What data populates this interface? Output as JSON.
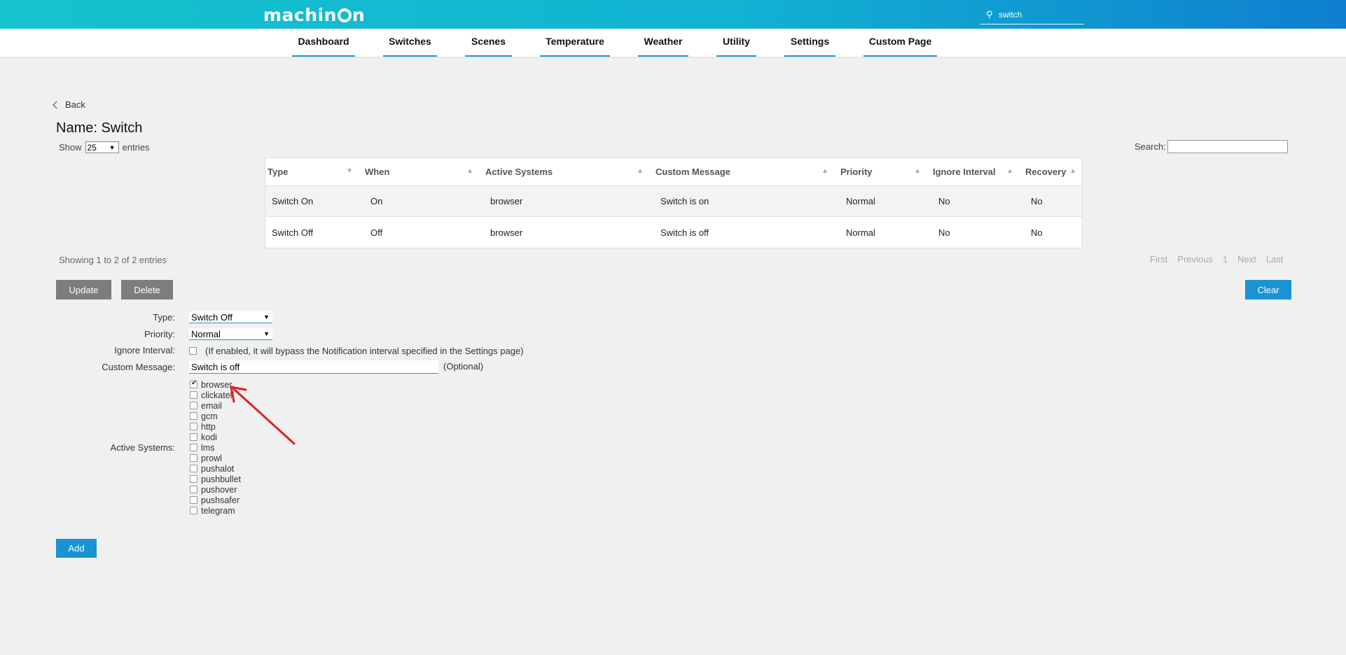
{
  "header": {
    "logo_text_1": "machin",
    "logo_text_2": "n",
    "search_value": "switch"
  },
  "nav": {
    "items": [
      "Dashboard",
      "Switches",
      "Scenes",
      "Temperature",
      "Weather",
      "Utility",
      "Settings",
      "Custom Page"
    ]
  },
  "page": {
    "back_label": "Back",
    "title": "Name: Switch"
  },
  "table_controls": {
    "show_label": "Show",
    "page_size": "25",
    "entries_label": "entries",
    "search_label": "Search:"
  },
  "table": {
    "columns": [
      "Type",
      "When",
      "Active Systems",
      "Custom Message",
      "Priority",
      "Ignore Interval",
      "Recovery"
    ],
    "rows": [
      [
        "Switch On",
        "On",
        "browser",
        "Switch is on",
        "Normal",
        "No",
        "No"
      ],
      [
        "Switch Off",
        "Off",
        "browser",
        "Switch is off",
        "Normal",
        "No",
        "No"
      ]
    ],
    "info": "Showing 1 to 2 of 2 entries",
    "paging": [
      "First",
      "Previous",
      "1",
      "Next",
      "Last"
    ]
  },
  "buttons": {
    "update": "Update",
    "delete": "Delete",
    "clear": "Clear",
    "add": "Add"
  },
  "form": {
    "type_label": "Type:",
    "type_value": "Switch Off",
    "priority_label": "Priority:",
    "priority_value": "Normal",
    "ignore_label": "Ignore Interval:",
    "ignore_text": "(If enabled, it will bypass the Notification interval specified in the Settings page)",
    "message_label": "Custom Message:",
    "message_value": "Switch is off",
    "optional_text": "(Optional)",
    "systems_label": "Active Systems:",
    "systems": [
      {
        "name": "browser",
        "checked": true
      },
      {
        "name": "clickatell",
        "checked": false
      },
      {
        "name": "email",
        "checked": false
      },
      {
        "name": "gcm",
        "checked": false
      },
      {
        "name": "http",
        "checked": false
      },
      {
        "name": "kodi",
        "checked": false
      },
      {
        "name": "lms",
        "checked": false
      },
      {
        "name": "prowl",
        "checked": false
      },
      {
        "name": "pushalot",
        "checked": false
      },
      {
        "name": "pushbullet",
        "checked": false
      },
      {
        "name": "pushover",
        "checked": false
      },
      {
        "name": "pushsafer",
        "checked": false
      },
      {
        "name": "telegram",
        "checked": false
      }
    ]
  },
  "colors": {
    "accent": "#1993d2",
    "header_start": "#15c3cd",
    "header_end": "#0e7fcf",
    "annotation_arrow": "#e31e1e"
  }
}
